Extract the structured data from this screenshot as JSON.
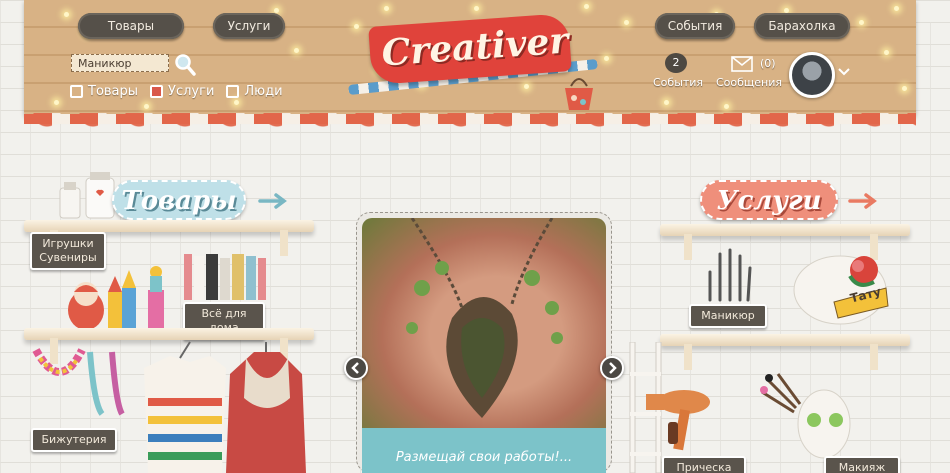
{
  "header": {
    "nav_left": [
      "Товары",
      "Услуги"
    ],
    "nav_right": [
      "События",
      "Барахолка"
    ],
    "logo_text": "Creativer",
    "search": {
      "value": "Маникюр"
    },
    "filters": [
      {
        "label": "Товары",
        "checked": false
      },
      {
        "label": "Услуги",
        "checked": true
      },
      {
        "label": "Люди",
        "checked": false
      }
    ],
    "events": {
      "count": "2",
      "label": "События"
    },
    "messages": {
      "count": "(0)",
      "label": "Сообщения"
    }
  },
  "sections": {
    "goods_title": "Товары",
    "services_title": "Услуги"
  },
  "categories": {
    "toys": [
      "Игрушки",
      "Сувениры"
    ],
    "home": "Всё для дома",
    "jewelry": "Бижутерия",
    "manicure": "Маникюр",
    "tattoo": "Тату",
    "hairdresser": "Прическа",
    "makeup": "Макияж"
  },
  "carousel": {
    "caption": "Размещай свои работы!..."
  },
  "colors": {
    "wood": "#d8b285",
    "accent_red": "#e0433b",
    "dark_label": "#5a544c",
    "teal": "#7cc3c9"
  }
}
